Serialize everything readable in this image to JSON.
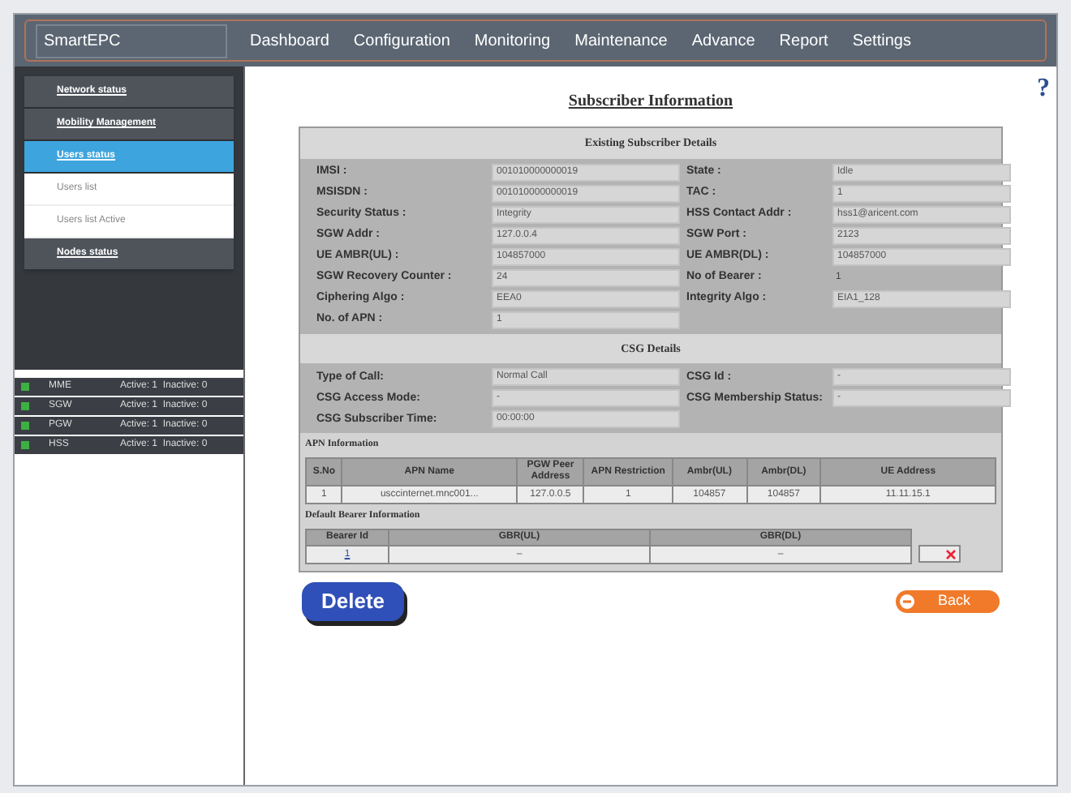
{
  "nav": {
    "brand": "SmartEPC",
    "items": [
      {
        "label": "Dashboard"
      },
      {
        "label": "Configuration"
      },
      {
        "label": "Monitoring"
      },
      {
        "label": "Maintenance"
      },
      {
        "label": "Advance"
      },
      {
        "label": "Report"
      },
      {
        "label": "Settings"
      }
    ]
  },
  "sidebar": {
    "menu": [
      {
        "label": "Network status",
        "kind": "header",
        "selected": false
      },
      {
        "label": "Mobility Management",
        "kind": "header",
        "selected": false
      },
      {
        "label": "Users status",
        "kind": "header",
        "selected": true
      },
      {
        "label": "Users list",
        "kind": "sub",
        "selected": false
      },
      {
        "label": "Users list Active",
        "kind": "sub",
        "selected": false
      },
      {
        "label": "Nodes status",
        "kind": "header",
        "selected": false
      }
    ],
    "nodes": [
      {
        "name": "MME",
        "status": "Active: 1  Inactive: 0",
        "color": "#3cb043"
      },
      {
        "name": "SGW",
        "status": "Active: 1  Inactive: 0",
        "color": "#3cb043"
      },
      {
        "name": "PGW",
        "status": "Active: 1  Inactive: 0",
        "color": "#3cb043"
      },
      {
        "name": "HSS",
        "status": "Active: 1  Inactive: 0",
        "color": "#3cb043"
      }
    ]
  },
  "help": "?",
  "title": "Subscriber Information",
  "details": {
    "title": "Existing Subscriber Details",
    "fields": [
      {
        "label": "IMSI :",
        "value": "001010000000019",
        "kind": "field"
      },
      {
        "label": "State :",
        "value": "Idle",
        "kind": "field"
      },
      {
        "label": "MSISDN :",
        "value": "001010000000019",
        "kind": "field"
      },
      {
        "label": "TAC :",
        "value": "1",
        "kind": "field"
      },
      {
        "label": "Security Status :",
        "value": "Integrity",
        "kind": "field"
      },
      {
        "label": "HSS Contact Addr :",
        "value": "hss1@aricent.com",
        "kind": "field"
      },
      {
        "label": "SGW Addr :",
        "value": "127.0.0.4",
        "kind": "field"
      },
      {
        "label": "SGW Port :",
        "value": "2123",
        "kind": "field"
      },
      {
        "label": "UE AMBR(UL) :",
        "value": "104857000",
        "kind": "field"
      },
      {
        "label": "UE AMBR(DL) :",
        "value": "104857000",
        "kind": "field"
      },
      {
        "label": "SGW Recovery Counter :",
        "value": "24",
        "kind": "field"
      },
      {
        "label": "No of Bearer :",
        "value": "1",
        "kind": "text"
      },
      {
        "label": "Ciphering Algo :",
        "value": "EEA0",
        "kind": "field"
      },
      {
        "label": "Integrity Algo :",
        "value": "EIA1_128",
        "kind": "field"
      },
      {
        "label": "No. of APN :",
        "value": "1",
        "kind": "field"
      }
    ]
  },
  "csg": {
    "title": "CSG Details",
    "fields": [
      {
        "label": "Type of Call:",
        "value": "Normal Call",
        "kind": "field"
      },
      {
        "label": "CSG Id :",
        "value": "-",
        "kind": "field"
      },
      {
        "label": "CSG Access Mode:",
        "value": "-",
        "kind": "field"
      },
      {
        "label": "CSG Membership Status:",
        "value": "-",
        "kind": "field"
      },
      {
        "label": "CSG Subscriber Time:",
        "value": "00:00:00",
        "kind": "field"
      }
    ]
  },
  "apn": {
    "title": "APN Information",
    "columns": [
      "S.No",
      "APN Name",
      "PGW Peer Address",
      "APN Restriction",
      "Ambr(UL)",
      "Ambr(DL)",
      "UE Address"
    ],
    "rows": [
      [
        "1",
        "usccinternet.mnc001...",
        "127.0.0.5",
        "1",
        "104857",
        "104857",
        "11.11.15.1"
      ]
    ]
  },
  "bearer": {
    "title": "Default Bearer Information",
    "columns": [
      "Bearer Id",
      "GBR(UL)",
      "GBR(DL)"
    ],
    "rows": [
      [
        "1",
        "–",
        "–"
      ]
    ]
  },
  "buttons": {
    "delete": "Delete",
    "back": "Back"
  }
}
